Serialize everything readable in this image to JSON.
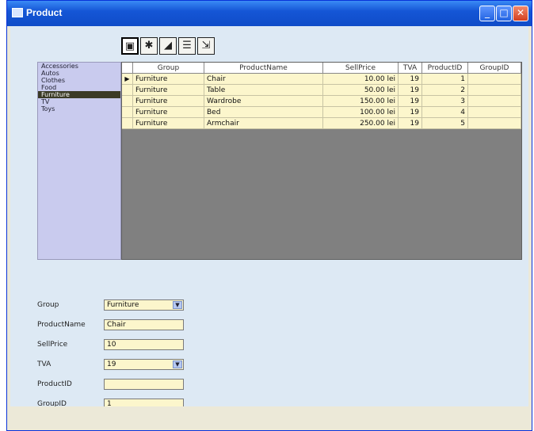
{
  "window": {
    "title": "Product",
    "icon": "grid-window-icon"
  },
  "toolbar": [
    {
      "icon": "form-view-icon",
      "glyph": "▣"
    },
    {
      "icon": "users-icon",
      "glyph": "✱"
    },
    {
      "icon": "chart-icon",
      "glyph": "◢"
    },
    {
      "icon": "table-view-icon",
      "glyph": "☰"
    },
    {
      "icon": "export-icon",
      "glyph": "⇲"
    }
  ],
  "nav": {
    "items": [
      {
        "label": "Accessories"
      },
      {
        "label": "Autos"
      },
      {
        "label": "Clothes"
      },
      {
        "label": "Food"
      },
      {
        "label": "Furniture"
      },
      {
        "label": "TV"
      },
      {
        "label": "Toys"
      }
    ]
  },
  "grid": {
    "columns": [
      "Group",
      "ProductName",
      "SellPrice",
      "TVA",
      "ProductID",
      "GroupID"
    ],
    "rows": [
      [
        "Furniture",
        "Chair",
        "10.00 lei",
        "19",
        "1",
        ""
      ],
      [
        "Furniture",
        "Table",
        "50.00 lei",
        "19",
        "2",
        ""
      ],
      [
        "Furniture",
        "Wardrobe",
        "150.00 lei",
        "19",
        "3",
        ""
      ],
      [
        "Furniture",
        "Bed",
        "100.00 lei",
        "19",
        "4",
        ""
      ],
      [
        "Furniture",
        "Armchair",
        "250.00 lei",
        "19",
        "5",
        ""
      ]
    ],
    "current_row_marker": "▶"
  },
  "form": {
    "group_label": "Group",
    "group_value": "Furniture",
    "product_name_label": "ProductName",
    "product_name_value": "Chair",
    "sell_price_label": "SellPrice",
    "sell_price_value": "10",
    "tva_label": "TVA",
    "tva_value": "19",
    "product_id_label": "ProductID",
    "product_id_value": "",
    "group_id_label": "GroupID",
    "group_id_value": "1"
  },
  "colors": {
    "titlebar": "#1556d6",
    "grid_row": "#fcf6cc",
    "nav_bg": "#c9cbee",
    "client_bg": "#dde9f4"
  }
}
